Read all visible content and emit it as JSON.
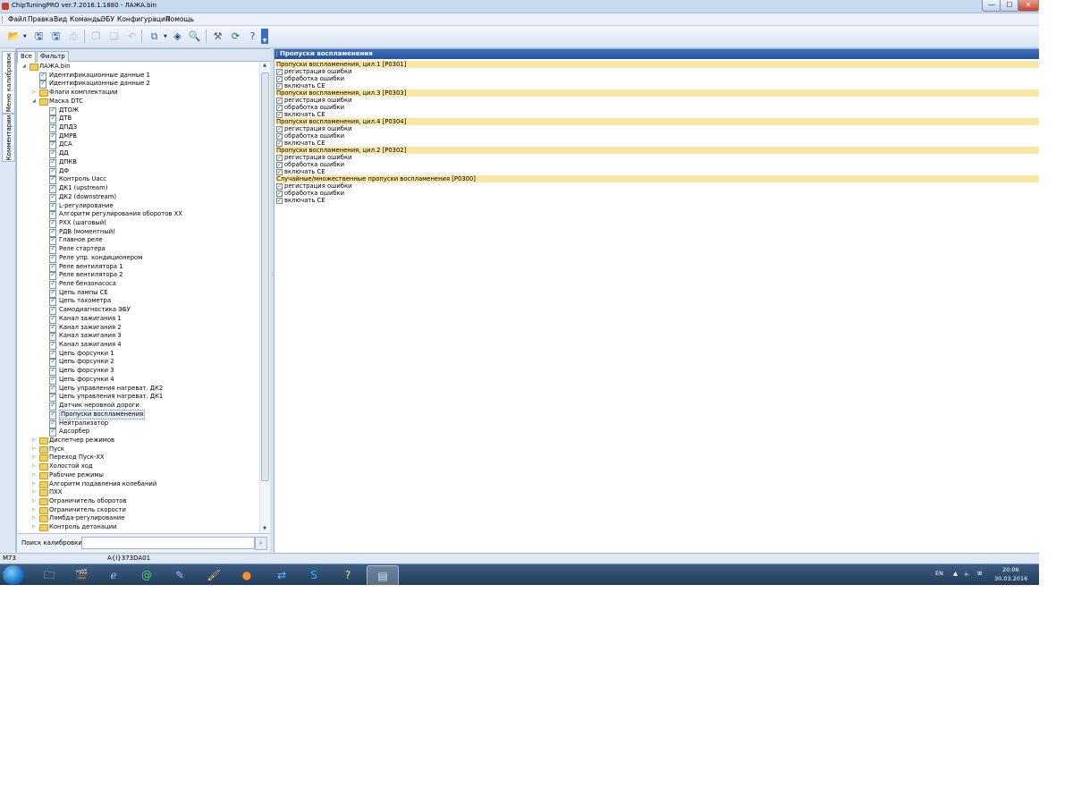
{
  "window": {
    "title": "ChipTuningPRO ver.7.2016.1.1880 - ЛАЖА.bin",
    "min": "—",
    "max": "☐",
    "close": "✕"
  },
  "menu": [
    "Файл",
    "Правка",
    "Вид",
    "Команды",
    "ЭБУ",
    "Конфигурация",
    "Помощь"
  ],
  "side_tabs": [
    "Меню калибровок",
    "Комментарии"
  ],
  "left_panel": {
    "tabs": [
      "Все",
      "Фильтр"
    ],
    "search_label": "Поиск калибровки",
    "search_value": ""
  },
  "tree": {
    "root": "ЛАЖА.bin",
    "id_items": [
      "Идентификационные данные 1",
      "Идентификационные данные 2"
    ],
    "flags_folder": "Флаги комплектации",
    "dtc_folder": "Маска DTC",
    "dtc_items": [
      "ДТОЖ",
      "ДТВ",
      "ДПДЗ",
      "ДМРВ",
      "ДСА",
      "ДД",
      "ДПКВ",
      "ДФ",
      "Контроль Uacc",
      "ДК1 (upstream)",
      "ДК2 (downstream)",
      "L-регулирование",
      "Алгоритм регулирования оборотов ХХ",
      "РХХ (шаговый)",
      "РДВ (моментный)",
      "Главное реле",
      "Реле стартера",
      "Реле упр. кондиционером",
      "Реле вентилятора 1",
      "Реле вентилятора 2",
      "Реле бензонасоса",
      "Цепь лампы CE",
      "Цепь тахометра",
      "Самодиагностика ЭБУ",
      "Канал зажигания 1",
      "Канал зажигания 2",
      "Канал зажигания 3",
      "Канал зажигания 4",
      "Цепь форсунки 1",
      "Цепь форсунки 2",
      "Цепь форсунки 3",
      "Цепь форсунки 4",
      "Цепь управления нагреват. ДК2",
      "Цепь управления нагреват. ДК1",
      "Датчик неровной дороги",
      "Пропуски воспламенения",
      "Нейтрализатор",
      "Адсорбер"
    ],
    "selected": "Пропуски воспламенения",
    "folders": [
      "Диспетчер режимов",
      "Пуск",
      "Переход Пуск-ХХ",
      "Холостой ход",
      "Рабочие режимы",
      "Алгоритм подавления колебаний",
      "ПХХ",
      "Ограничитель оборотов",
      "Ограничитель скорости",
      "Лямбда-регулирование",
      "Контроль детонации"
    ]
  },
  "right_panel": {
    "header": "Пропуски воспламенения",
    "sections": [
      {
        "title": "Пропуски воспламенения, цил.1 [P0301]",
        "options": [
          "регистрация ошибки",
          "обработка ошибки",
          "включать CE"
        ]
      },
      {
        "title": "Пропуски воспламенения, цил.3 [P0303]",
        "options": [
          "регистрация ошибки",
          "обработка ошибки",
          "включать CE"
        ]
      },
      {
        "title": "Пропуски воспламенения, цил.4 [P0304]",
        "options": [
          "регистрация ошибки",
          "обработка ошибки",
          "включать CE"
        ]
      },
      {
        "title": "Пропуски воспламенения, цил.2 [P0302]",
        "options": [
          "регистрация ошибки",
          "обработка ошибки",
          "включать CE"
        ]
      },
      {
        "title": "Случайные/множественные пропуски воспламенения [P0300]",
        "options": [
          "регистрация ошибки",
          "обработка ошибки",
          "включать CE"
        ]
      }
    ],
    "check_glyph": "✓"
  },
  "status": {
    "ecu": "M73",
    "firmware": "A{I}373DA01"
  },
  "taskbar": {
    "lang": "EN",
    "time": "20:06",
    "date": "30.03.2016",
    "apps": [
      "explorer",
      "media-center",
      "ie",
      "email",
      "pin",
      "paint",
      "firefox",
      "teamviewer",
      "skype",
      "notes",
      "chiptuning"
    ]
  }
}
